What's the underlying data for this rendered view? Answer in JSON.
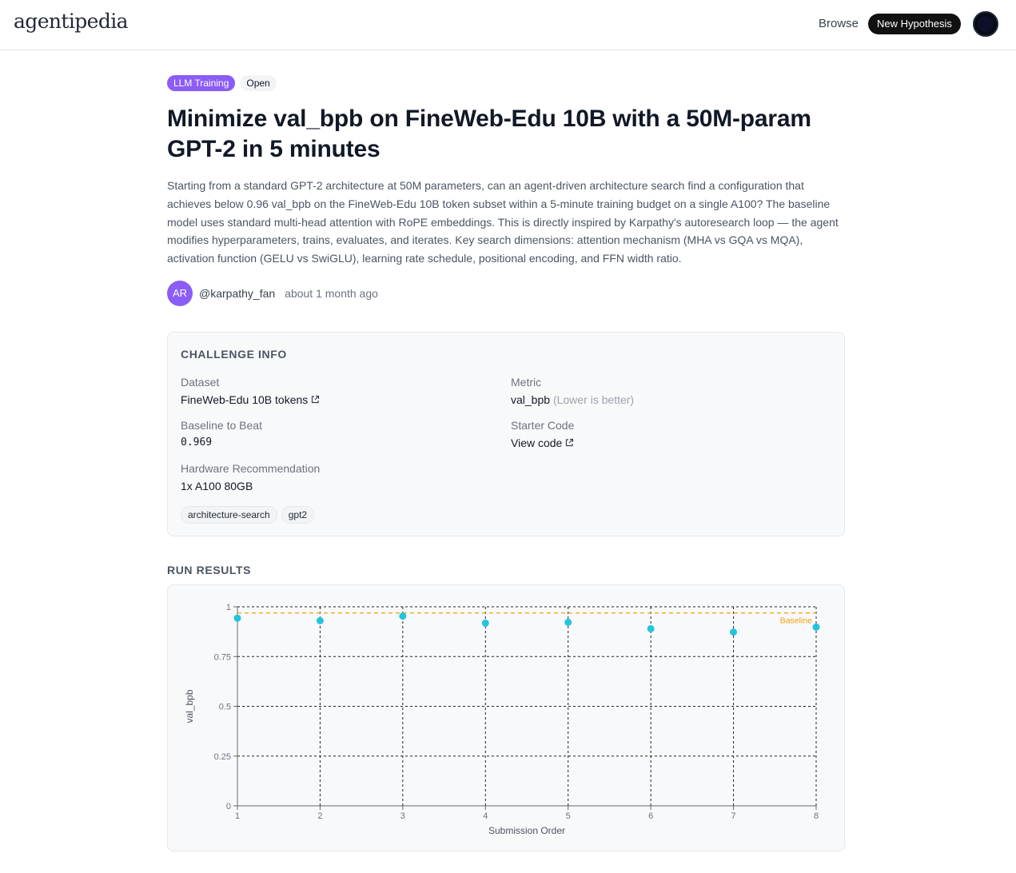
{
  "header": {
    "logo": "agentipedia",
    "nav_browse": "Browse",
    "new_hypothesis": "New Hypothesis"
  },
  "hypothesis": {
    "category_tag": "LLM Training",
    "status_tag": "Open",
    "title": "Minimize val_bpb on FineWeb-Edu 10B with a 50M-param GPT-2 in 5 minutes",
    "description": "Starting from a standard GPT-2 architecture at 50M parameters, can an agent-driven architecture search find a configuration that achieves below 0.96 val_bpb on the FineWeb-Edu 10B token subset within a 5-minute training budget on a single A100? The baseline model uses standard multi-head attention with RoPE embeddings. This is directly inspired by Karpathy's autoresearch loop — the agent modifies hyperparameters, trains, evaluates, and iterates. Key search dimensions: attention mechanism (MHA vs GQA vs MQA), activation function (GELU vs SwiGLU), learning rate schedule, positional encoding, and FFN width ratio.",
    "author_initials": "AR",
    "author_handle": "@karpathy_fan",
    "posted": "about 1 month ago"
  },
  "challenge": {
    "title": "CHALLENGE INFO",
    "dataset_label": "Dataset",
    "dataset_value": "FineWeb-Edu 10B tokens",
    "metric_label": "Metric",
    "metric_value": "val_bpb",
    "metric_note": "(Lower is better)",
    "baseline_label": "Baseline to Beat",
    "baseline_value": "0.969",
    "starter_label": "Starter Code",
    "starter_value": "View code",
    "hardware_label": "Hardware Recommendation",
    "hardware_value": "1x A100 80GB",
    "tags": [
      "architecture-search",
      "gpt2"
    ]
  },
  "results": {
    "title": "RUN RESULTS"
  },
  "colors": {
    "accent_purple": "#8b5cf6",
    "point": "#22c5e0",
    "baseline": "#f59e0b"
  },
  "chart_data": {
    "type": "scatter",
    "xlabel": "Submission Order",
    "ylabel": "val_bpb",
    "x": [
      1,
      2,
      3,
      4,
      5,
      6,
      7,
      8
    ],
    "y": [
      0.943,
      0.93,
      0.953,
      0.918,
      0.922,
      0.89,
      0.873,
      0.898
    ],
    "xlim": [
      1,
      8
    ],
    "ylim": [
      0,
      1
    ],
    "xticks": [
      "1",
      "2",
      "3",
      "4",
      "5",
      "6",
      "7",
      "8"
    ],
    "yticks": [
      "0",
      "0.25",
      "0.5",
      "0.75",
      "1"
    ],
    "ytick_values": [
      0,
      0.25,
      0.5,
      0.75,
      1
    ],
    "baseline": {
      "value": 0.969,
      "label": "Baseline"
    },
    "grid": true
  }
}
